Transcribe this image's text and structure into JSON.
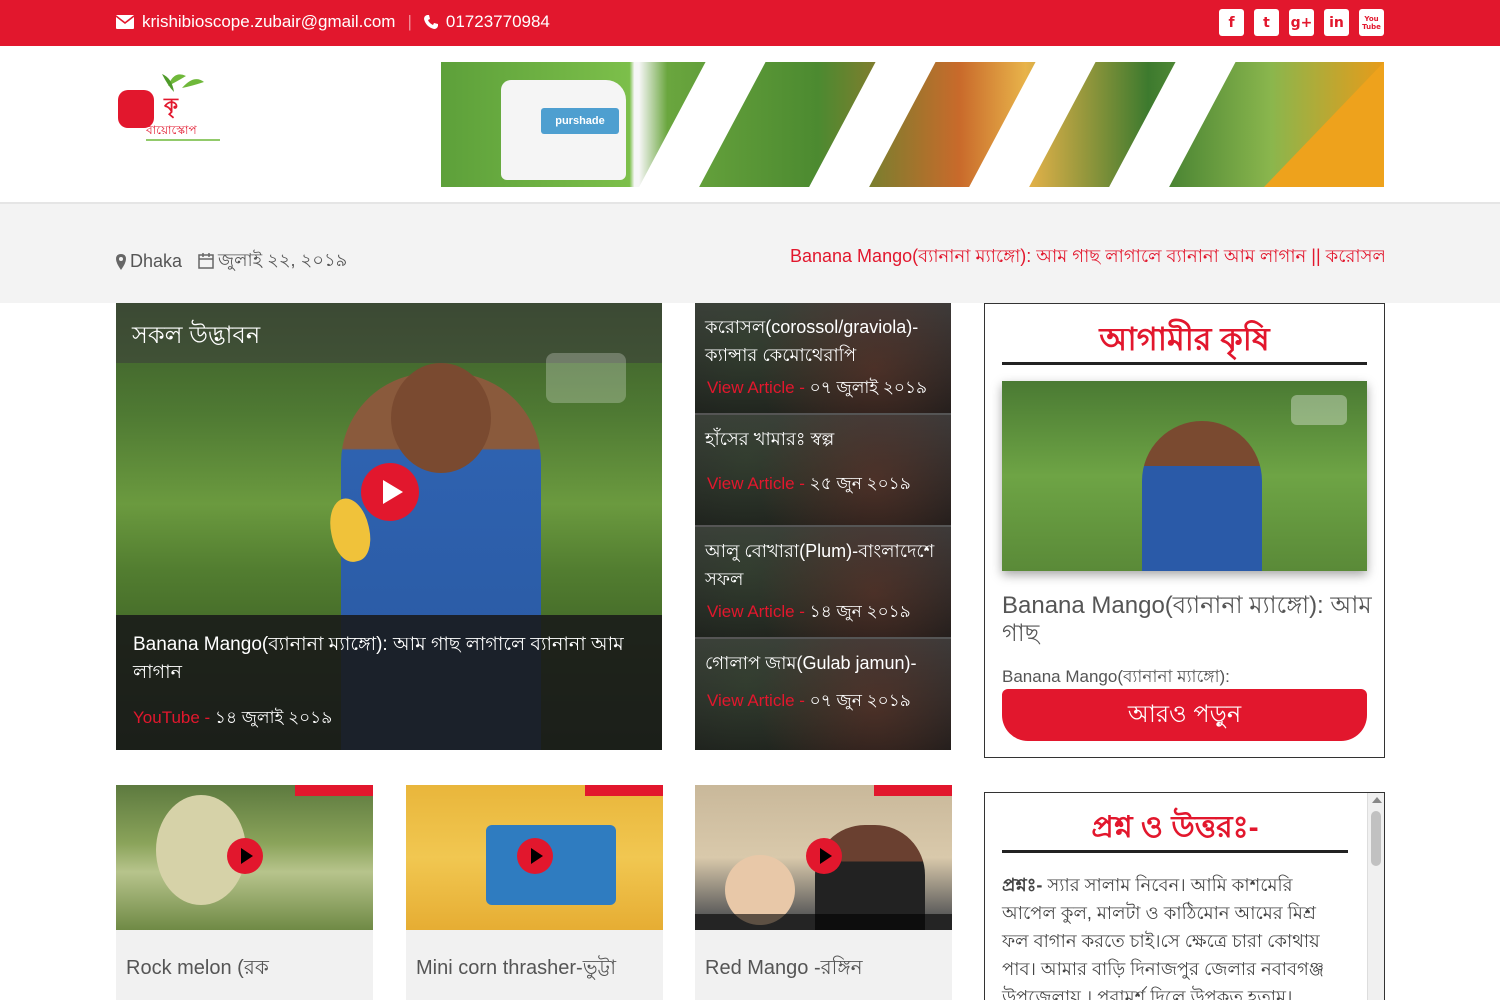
{
  "topbar": {
    "email": "krishibioscope.zubair@gmail.com",
    "phone": "01723770984",
    "social": [
      {
        "icon": "facebook-icon",
        "label": "f"
      },
      {
        "icon": "twitter-icon",
        "label": "t"
      },
      {
        "icon": "google-plus-icon",
        "label": "g+"
      },
      {
        "icon": "linkedin-icon",
        "label": "in"
      },
      {
        "icon": "youtube-icon",
        "label": "You Tube"
      }
    ],
    "color": "#e2172d"
  },
  "header": {
    "logo_text": "কৃষি বায়োস্কোপ",
    "banner_label": "purshade"
  },
  "locbar": {
    "location": "Dhaka",
    "date": "জুলাই ২২, ২০১৯",
    "ticker": "Banana Mango(ব্যানানা ম্যাঙ্গো): আম গাছ লাগালে ব্যানানা আম লাগান || করোসল(corossol/graviola)-ক্যান্সার কেমোথেরাপি"
  },
  "featured": {
    "section": "সকল উদ্ভাবন",
    "title": "Banana Mango(ব্যানানা ম্যাঙ্গো): আম গাছ লাগালে ব্যানানা আম লাগান",
    "source": "YouTube - ",
    "date": "১৪ জুলাই ২০১৯"
  },
  "side_list": [
    {
      "title": "করোসল(corossol/graviola)-ক্যান্সার কেমোথেরাপি",
      "link": "View Article - ",
      "date": "০৭ জুলাই ২০১৯"
    },
    {
      "title": "হাঁসের খামারঃ স্বল্প",
      "link": "View Article - ",
      "date": "২৫ জুন ২০১৯"
    },
    {
      "title": "আলু বোখারা(Plum)-বাংলাদেশে সফল",
      "link": "View Article - ",
      "date": "১৪ জুন ২০১৯"
    },
    {
      "title": "গোলাপ জাম(Gulab jamun)-",
      "link": "View Article - ",
      "date": "০৭ জুন ২০১৯"
    }
  ],
  "widget_future": {
    "title": "আগামীর কৃষি",
    "video_title": "Banana Mango(ব্যানানা ম্যাঙ্গো): আম গাছ",
    "video_desc": "Banana Mango(ব্যানানা ম্যাঙ্গো):",
    "button": "আরও পড়ুন"
  },
  "widget_qa": {
    "title": "প্রশ্ন ও উত্তরঃ-",
    "q_label": "প্রশ্নঃ-",
    "q_text": " স্যার সালাম নিবেন। আমি কাশমেরি আপেল কুল, মালটা ও কাঠিমোন আমের মিশ্র ফল বাগান করতে চাই।সে ক্ষেত্রে চারা কোথায় পাব। আমার বাড়ি দিনাজপুর জেলার নবাবগঞ্জ উপজেলায় । পরামর্শ দিলে উপকৃত হতাম।"
  },
  "cards": [
    {
      "title": "Rock melon (রক"
    },
    {
      "title": "Mini corn thrasher-ভুট্টা"
    },
    {
      "title": "Red Mango -রঙ্গিন"
    }
  ]
}
